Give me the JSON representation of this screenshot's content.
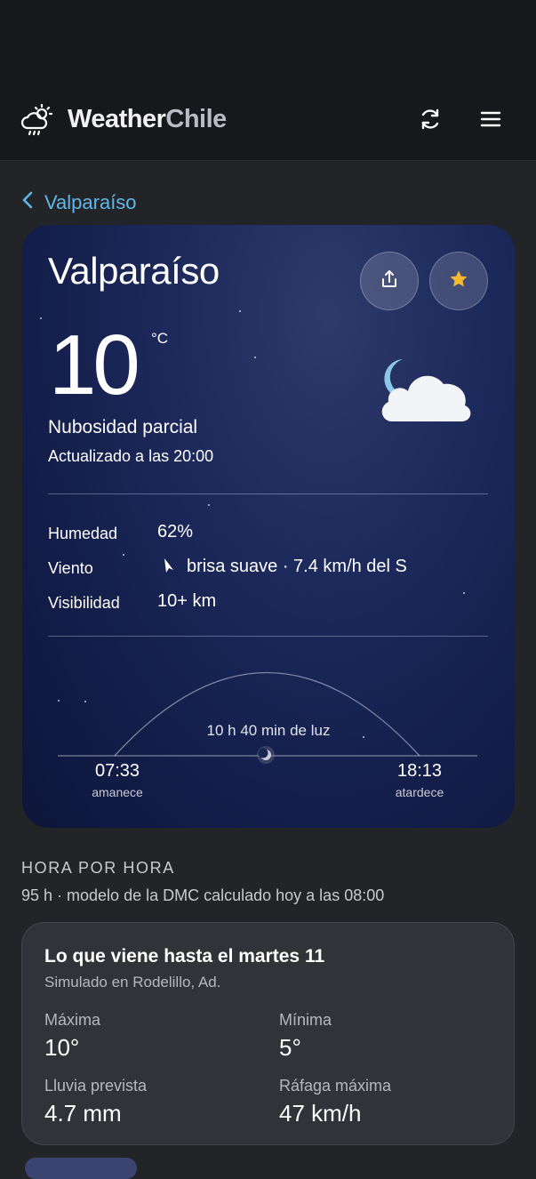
{
  "header": {
    "brand_part1": "Weather",
    "brand_part2": "Chile",
    "icons": {
      "logo": "cloud-sun-rain-icon",
      "refresh": "refresh-icon",
      "menu": "hamburger-menu-icon"
    }
  },
  "breadcrumb": {
    "label": "Valparaíso",
    "icon": "chevron-left-icon"
  },
  "current": {
    "city": "Valparaíso",
    "temperature": "10",
    "unit": "°C",
    "condition": "Nubosidad parcial",
    "updated": "Actualizado a las 20:00",
    "icon": "moon-cloud-icon",
    "actions": {
      "share_icon": "share-icon",
      "favorite_icon": "star-icon"
    }
  },
  "stats": [
    {
      "label": "Humedad",
      "value": "62%"
    },
    {
      "label": "Viento",
      "value": "brisa suave · 7.4 km/h del S"
    },
    {
      "label": "Visibilidad",
      "value": "10+ km"
    }
  ],
  "sun": {
    "daylight": "10 h 40 min de luz",
    "sunrise_time": "07:33",
    "sunrise_label": "amanece",
    "sunset_time": "18:13",
    "sunset_label": "atardece"
  },
  "hourly": {
    "title": "HORA POR HORA",
    "subtitle": "95 h · modelo de la DMC calculado hoy a las 08:00"
  },
  "forecast": {
    "title": "Lo que viene hasta el martes 11",
    "subtitle": "Simulado en Rodelillo, Ad.",
    "items": [
      {
        "label": "Máxima",
        "value": "10°"
      },
      {
        "label": "Mínima",
        "value": "5°"
      },
      {
        "label": "Lluvia prevista",
        "value": "4.7 mm"
      },
      {
        "label": "Ráfaga máxima",
        "value": "47 km/h"
      }
    ]
  },
  "colors": {
    "accent": "#5fb6e8",
    "star": "#f5b82e",
    "background": "#232427",
    "hero_top": "#1d2a5c",
    "hero_bottom": "#0d153a"
  }
}
